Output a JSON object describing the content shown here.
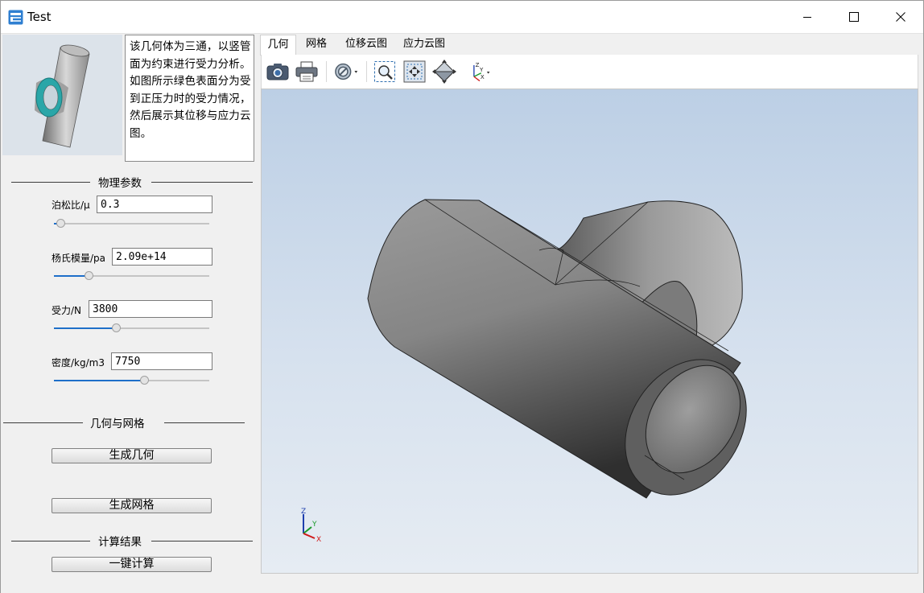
{
  "window": {
    "title": "Test",
    "icons": {
      "app": "app-icon",
      "minimize": "minimize-icon",
      "maximize": "maximize-icon",
      "close": "close-icon"
    }
  },
  "preview": {
    "icon": "tee-pipe-thumbnail",
    "description": "该几何体为三通，以竖管面为约束进行受力分析。如图所示绿色表面分为受到正压力时的受力情况，然后展示其位移与应力云图。"
  },
  "physics": {
    "header": "物理参数",
    "params": [
      {
        "label": "泊松比/μ",
        "value": "0.3",
        "slider_fraction": 0.02
      },
      {
        "label": "杨氏模量/pa",
        "value": "2.09e+14",
        "slider_fraction": 0.2
      },
      {
        "label": "受力/N",
        "value": "3800",
        "slider_fraction": 0.38
      },
      {
        "label": "密度/kg/m3",
        "value": "7750",
        "slider_fraction": 0.56
      }
    ],
    "accent_color": "#1e6fc9"
  },
  "geometry_group": {
    "header": "几何与网格",
    "gen_geometry_label": "生成几何",
    "gen_mesh_label": "生成网格"
  },
  "results_group": {
    "header": "计算结果",
    "compute_label": "一键计算"
  },
  "tabs": [
    {
      "label": "几何",
      "active": true
    },
    {
      "label": "网格",
      "active": false
    },
    {
      "label": "位移云图",
      "active": false
    },
    {
      "label": "应力云图",
      "active": false
    }
  ],
  "toolbar": {
    "icons": [
      "camera-icon",
      "print-icon",
      "display-mode-icon",
      "zoom-window-icon",
      "fit-all-icon",
      "view-cube-icon",
      "axis-orientation-icon"
    ]
  },
  "viewport": {
    "background_top": "#bccfe5",
    "background_bottom": "#e6ecf3",
    "model": "tee-pipe",
    "axis": {
      "z": "Z",
      "y": "Y",
      "x": "X"
    }
  }
}
